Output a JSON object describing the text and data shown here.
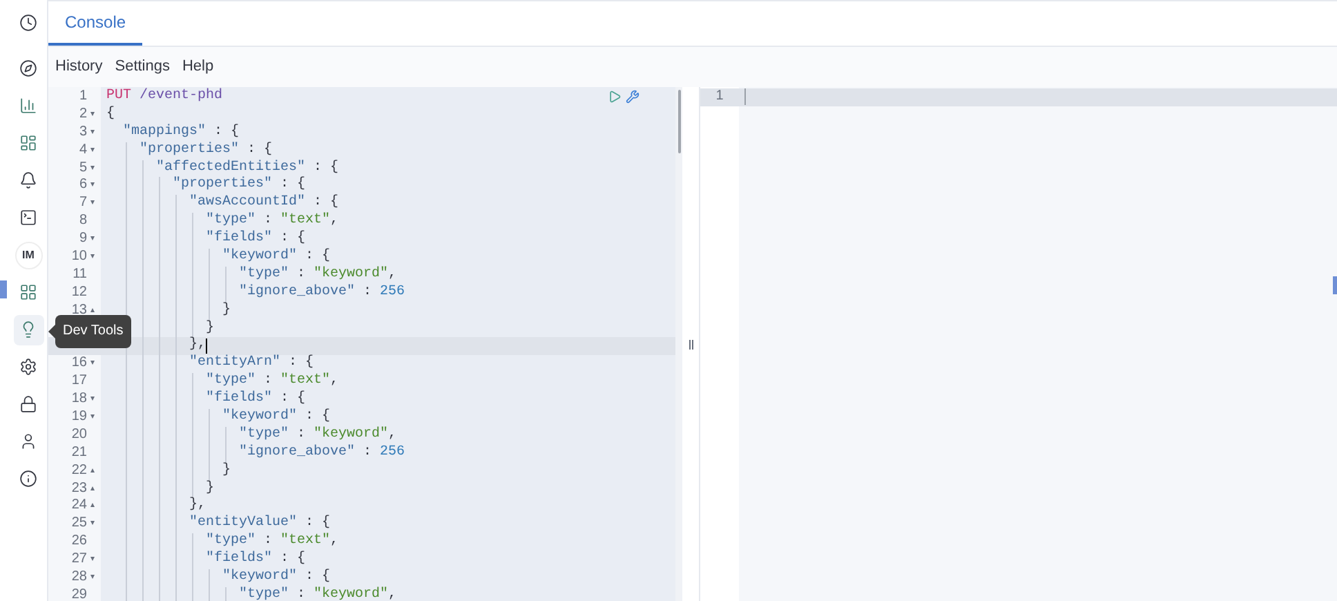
{
  "sidebar": {
    "items": [
      {
        "kind": "icon",
        "hovered": false
      },
      {
        "kind": "icon",
        "hovered": false
      },
      {
        "kind": "icon",
        "hovered": false
      },
      {
        "kind": "icon",
        "hovered": false
      },
      {
        "kind": "icon",
        "hovered": false
      },
      {
        "kind": "icon",
        "hovered": false
      },
      {
        "kind": "text",
        "text": "IM",
        "hovered": false
      },
      {
        "kind": "icon",
        "hovered": false
      },
      {
        "kind": "icon",
        "hovered": true,
        "tooltip": "Dev Tools"
      },
      {
        "kind": "icon",
        "hovered": false
      },
      {
        "kind": "icon",
        "hovered": false
      },
      {
        "kind": "icon",
        "hovered": false
      },
      {
        "kind": "icon",
        "hovered": false
      }
    ]
  },
  "tabs": [
    {
      "label": "Console",
      "selected": true
    }
  ],
  "menu": [
    "History",
    "Settings",
    "Help"
  ],
  "request_editor": {
    "lines": [
      {
        "number": "1",
        "active": false,
        "tokens": [
          {
            "kind": "method",
            "text": "PUT"
          },
          {
            "kind": "url",
            "text": " /event-phd"
          }
        ]
      },
      {
        "number": "2",
        "fold": "▾",
        "active": false,
        "tokens": [
          {
            "kind": "punct",
            "text": "{"
          }
        ]
      },
      {
        "number": "3",
        "fold": "▾",
        "active": false,
        "tokens": [
          {
            "kind": "key",
            "text": "  \"mappings\""
          },
          {
            "kind": "punct",
            "text": " : {"
          }
        ]
      },
      {
        "number": "4",
        "fold": "▾",
        "active": false,
        "tokens": [
          {
            "kind": "key",
            "text": "    \"properties\""
          },
          {
            "kind": "punct",
            "text": " : {"
          }
        ]
      },
      {
        "number": "5",
        "fold": "▾",
        "active": false,
        "tokens": [
          {
            "kind": "key",
            "text": "      \"affectedEntities\""
          },
          {
            "kind": "punct",
            "text": " : {"
          }
        ]
      },
      {
        "number": "6",
        "fold": "▾",
        "active": false,
        "tokens": [
          {
            "kind": "key",
            "text": "        \"properties\""
          },
          {
            "kind": "punct",
            "text": " : {"
          }
        ]
      },
      {
        "number": "7",
        "fold": "▾",
        "active": false,
        "tokens": [
          {
            "kind": "key",
            "text": "          \"awsAccountId\""
          },
          {
            "kind": "punct",
            "text": " : {"
          }
        ]
      },
      {
        "number": "8",
        "active": false,
        "tokens": [
          {
            "kind": "key",
            "text": "            \"type\""
          },
          {
            "kind": "punct",
            "text": " : "
          },
          {
            "kind": "string",
            "text": "\"text\""
          },
          {
            "kind": "punct",
            "text": ","
          }
        ]
      },
      {
        "number": "9",
        "fold": "▾",
        "active": false,
        "tokens": [
          {
            "kind": "key",
            "text": "            \"fields\""
          },
          {
            "kind": "punct",
            "text": " : {"
          }
        ]
      },
      {
        "number": "10",
        "fold": "▾",
        "active": false,
        "tokens": [
          {
            "kind": "key",
            "text": "              \"keyword\""
          },
          {
            "kind": "punct",
            "text": " : {"
          }
        ]
      },
      {
        "number": "11",
        "active": false,
        "tokens": [
          {
            "kind": "key",
            "text": "                \"type\""
          },
          {
            "kind": "punct",
            "text": " : "
          },
          {
            "kind": "string",
            "text": "\"keyword\""
          },
          {
            "kind": "punct",
            "text": ","
          }
        ]
      },
      {
        "number": "12",
        "active": false,
        "tokens": [
          {
            "kind": "key",
            "text": "                \"ignore_above\""
          },
          {
            "kind": "punct",
            "text": " : "
          },
          {
            "kind": "number",
            "text": "256"
          }
        ]
      },
      {
        "number": "13",
        "fold": "▴",
        "active": false,
        "tokens": [
          {
            "kind": "punct",
            "text": "              }"
          }
        ]
      },
      {
        "active": false,
        "tokens": [
          {
            "kind": "punct",
            "text": "            }"
          }
        ]
      },
      {
        "active": true,
        "tokens": [
          {
            "kind": "punct",
            "text": "          },"
          }
        ]
      },
      {
        "number": "16",
        "fold": "▾",
        "active": false,
        "tokens": [
          {
            "kind": "key",
            "text": "          \"entityArn\""
          },
          {
            "kind": "punct",
            "text": " : {"
          }
        ]
      },
      {
        "number": "17",
        "active": false,
        "tokens": [
          {
            "kind": "key",
            "text": "            \"type\""
          },
          {
            "kind": "punct",
            "text": " : "
          },
          {
            "kind": "string",
            "text": "\"text\""
          },
          {
            "kind": "punct",
            "text": ","
          }
        ]
      },
      {
        "number": "18",
        "fold": "▾",
        "active": false,
        "tokens": [
          {
            "kind": "key",
            "text": "            \"fields\""
          },
          {
            "kind": "punct",
            "text": " : {"
          }
        ]
      },
      {
        "number": "19",
        "fold": "▾",
        "active": false,
        "tokens": [
          {
            "kind": "key",
            "text": "              \"keyword\""
          },
          {
            "kind": "punct",
            "text": " : {"
          }
        ]
      },
      {
        "number": "20",
        "active": false,
        "tokens": [
          {
            "kind": "key",
            "text": "                \"type\""
          },
          {
            "kind": "punct",
            "text": " : "
          },
          {
            "kind": "string",
            "text": "\"keyword\""
          },
          {
            "kind": "punct",
            "text": ","
          }
        ]
      },
      {
        "number": "21",
        "active": false,
        "tokens": [
          {
            "kind": "key",
            "text": "                \"ignore_above\""
          },
          {
            "kind": "punct",
            "text": " : "
          },
          {
            "kind": "number",
            "text": "256"
          }
        ]
      },
      {
        "number": "22",
        "fold": "▴",
        "active": false,
        "tokens": [
          {
            "kind": "punct",
            "text": "              }"
          }
        ]
      },
      {
        "number": "23",
        "fold": "▴",
        "active": false,
        "tokens": [
          {
            "kind": "punct",
            "text": "            }"
          }
        ]
      },
      {
        "number": "24",
        "fold": "▴",
        "active": false,
        "tokens": [
          {
            "kind": "punct",
            "text": "          },"
          }
        ]
      },
      {
        "number": "25",
        "fold": "▾",
        "active": false,
        "tokens": [
          {
            "kind": "key",
            "text": "          \"entityValue\""
          },
          {
            "kind": "punct",
            "text": " : {"
          }
        ]
      },
      {
        "number": "26",
        "active": false,
        "tokens": [
          {
            "kind": "key",
            "text": "            \"type\""
          },
          {
            "kind": "punct",
            "text": " : "
          },
          {
            "kind": "string",
            "text": "\"text\""
          },
          {
            "kind": "punct",
            "text": ","
          }
        ]
      },
      {
        "number": "27",
        "fold": "▾",
        "active": false,
        "tokens": [
          {
            "kind": "key",
            "text": "            \"fields\""
          },
          {
            "kind": "punct",
            "text": " : {"
          }
        ]
      },
      {
        "number": "28",
        "fold": "▾",
        "active": false,
        "tokens": [
          {
            "kind": "key",
            "text": "              \"keyword\""
          },
          {
            "kind": "punct",
            "text": " : {"
          }
        ]
      },
      {
        "number": "29",
        "active": false,
        "tokens": [
          {
            "kind": "key",
            "text": "                \"type\""
          },
          {
            "kind": "punct",
            "text": " : "
          },
          {
            "kind": "string",
            "text": "\"keyword\""
          },
          {
            "kind": "punct",
            "text": ","
          }
        ]
      }
    ]
  },
  "response_editor": {
    "lines": [
      {
        "number": "1",
        "active": true
      }
    ]
  }
}
